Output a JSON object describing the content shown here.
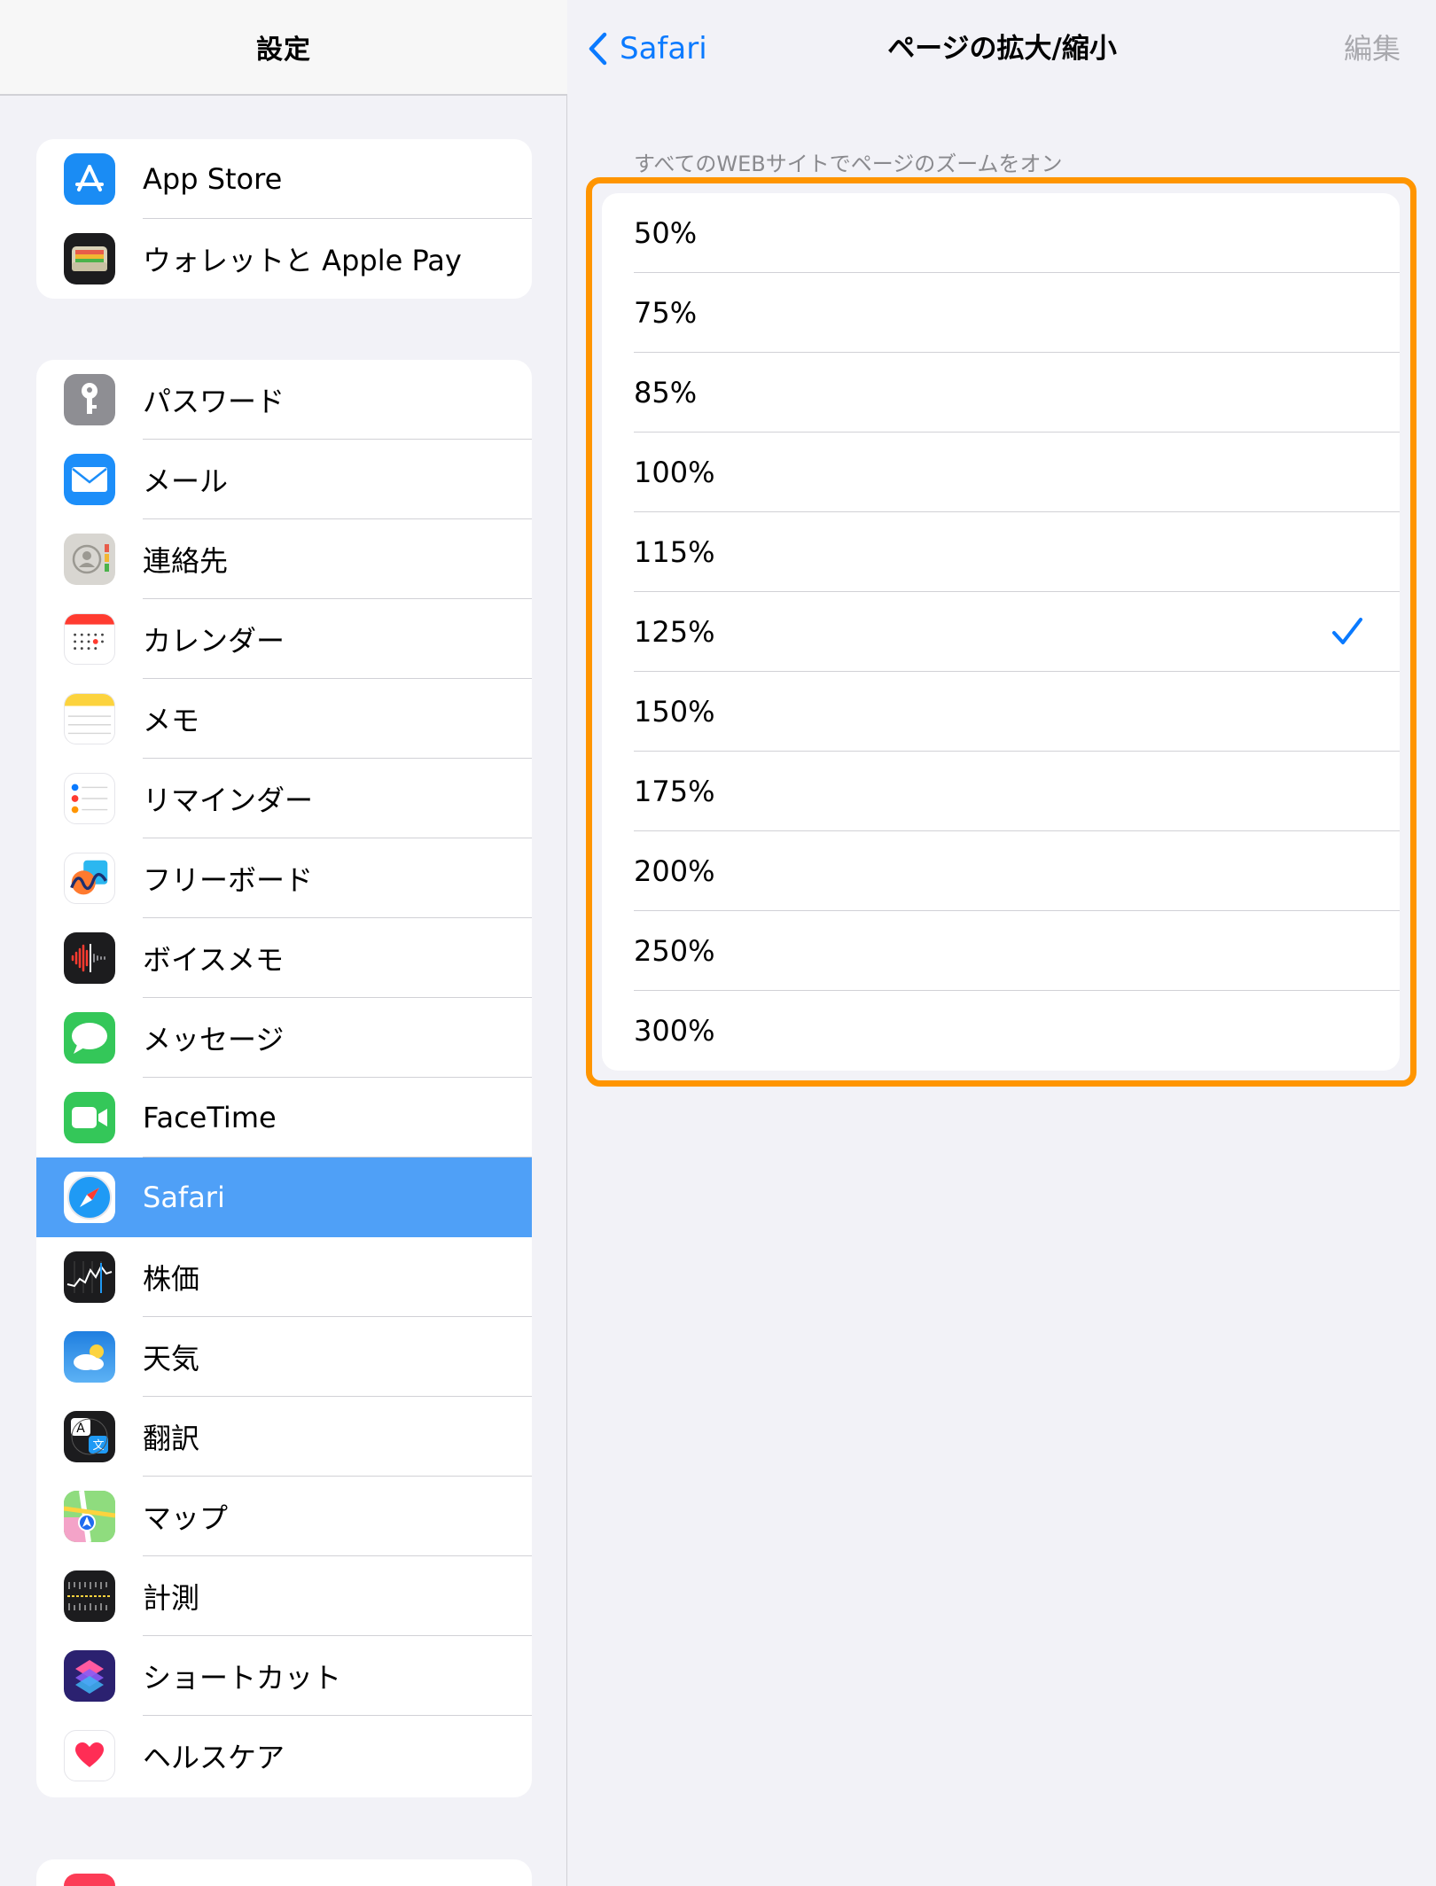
{
  "sidebar": {
    "title": "設定",
    "groups": [
      {
        "items": [
          {
            "label": "App Store",
            "icon": "app-store-icon",
            "color": "#1a8cf4"
          },
          {
            "label": "ウォレットと Apple Pay",
            "icon": "wallet-icon",
            "color": "#1c1c1e"
          }
        ]
      },
      {
        "items": [
          {
            "label": "パスワード",
            "icon": "key-icon",
            "color": "#8e8e93"
          },
          {
            "label": "メール",
            "icon": "mail-icon",
            "color": "#1c8ef9"
          },
          {
            "label": "連絡先",
            "icon": "contacts-icon",
            "color": "#d8d6d1"
          },
          {
            "label": "カレンダー",
            "icon": "calendar-icon",
            "color": "#ffffff"
          },
          {
            "label": "メモ",
            "icon": "notes-icon",
            "color": "#ffffff"
          },
          {
            "label": "リマインダー",
            "icon": "reminders-icon",
            "color": "#ffffff"
          },
          {
            "label": "フリーボード",
            "icon": "freeform-icon",
            "color": "#ffffff"
          },
          {
            "label": "ボイスメモ",
            "icon": "voice-memos-icon",
            "color": "#1c1c1e"
          },
          {
            "label": "メッセージ",
            "icon": "messages-icon",
            "color": "#34c759"
          },
          {
            "label": "FaceTime",
            "icon": "facetime-icon",
            "color": "#34c759"
          },
          {
            "label": "Safari",
            "icon": "safari-icon",
            "color": "#ffffff",
            "selected": true
          },
          {
            "label": "株価",
            "icon": "stocks-icon",
            "color": "#1c1c1e"
          },
          {
            "label": "天気",
            "icon": "weather-icon",
            "color": "#2f8ae8"
          },
          {
            "label": "翻訳",
            "icon": "translate-icon",
            "color": "#1c1c1e"
          },
          {
            "label": "マップ",
            "icon": "maps-icon",
            "color": "#7bd67a"
          },
          {
            "label": "計測",
            "icon": "measure-icon",
            "color": "#1c1c1e"
          },
          {
            "label": "ショートカット",
            "icon": "shortcuts-icon",
            "color": "#3b2a8f"
          },
          {
            "label": "ヘルスケア",
            "icon": "health-icon",
            "color": "#ffffff"
          }
        ]
      }
    ]
  },
  "detail": {
    "back_label": "Safari",
    "title": "ページの拡大/縮小",
    "edit_label": "編集",
    "section_caption": "すべてのWEBサイトでページのズームをオン",
    "options": [
      "50%",
      "75%",
      "85%",
      "100%",
      "115%",
      "125%",
      "150%",
      "175%",
      "200%",
      "250%",
      "300%"
    ],
    "selected": "125%"
  },
  "colors": {
    "accent": "#0a7aff",
    "highlight": "#ff9500",
    "selected_row": "#4fa0f7"
  }
}
